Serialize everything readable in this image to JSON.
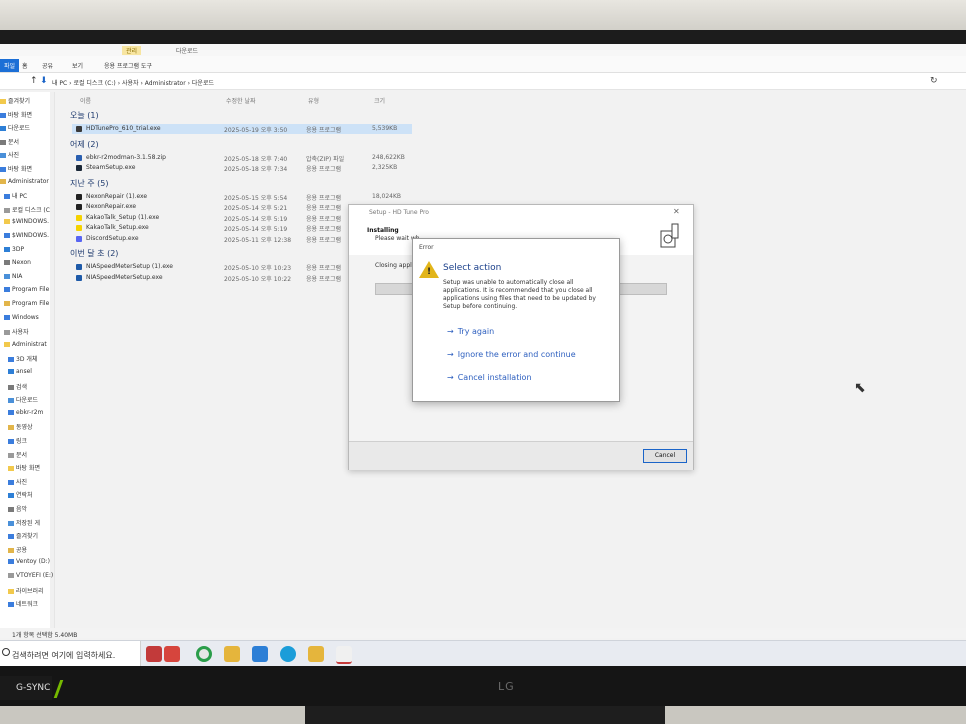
{
  "explorer": {
    "ribbon_tabs": {
      "manage": "관리",
      "downloads": "다운로드"
    },
    "ribbon": {
      "file": "파일",
      "home": "홈",
      "share": "공유",
      "view": "보기",
      "app_tools": "응용 프로그램 도구"
    },
    "address": {
      "crumbs": [
        "내 PC",
        "로컬 디스크 (C:)",
        "사용자",
        "Administrator",
        "다운로드"
      ]
    },
    "columns": {
      "name": "이름",
      "date": "수정한 날짜",
      "type": "유형",
      "size": "크기"
    },
    "nav_items": [
      "즐겨찾기",
      "바탕 화면",
      "다운로드",
      "문서",
      "사진",
      "바탕 화면",
      "Administrator",
      "내 PC",
      "로컬 디스크 (C",
      "$WINDOWS.",
      "$WINDOWS.",
      "3DP",
      "Nexon",
      "NIA",
      "Program File",
      "Program File",
      "Windows",
      "사용자",
      "Administrat",
      "3D 개체",
      "ansel",
      "검색",
      "다운로드",
      "ebkr-r2m",
      "동영상",
      "링크",
      "문서",
      "바탕 화면",
      "사진",
      "연락처",
      "음악",
      "저장된 게",
      "즐겨찾기",
      "공용",
      "Ventoy (D:)",
      "VTOYEFI (E:)",
      "라이브러리",
      "네트워크"
    ],
    "groups": [
      {
        "label": "오늘 (1)",
        "files": [
          {
            "name": "HDTunePro_610_trial.exe",
            "date": "2025-05-19 오후 3:50",
            "type": "응용 프로그램",
            "size": "5,539KB",
            "selected": true
          }
        ]
      },
      {
        "label": "어제 (2)",
        "files": [
          {
            "name": "ebkr-r2modman-3.1.58.zip",
            "date": "2025-05-18 오후 7:40",
            "type": "압축(ZIP) 파일",
            "size": "248,622KB"
          },
          {
            "name": "SteamSetup.exe",
            "date": "2025-05-18 오후 7:34",
            "type": "응용 프로그램",
            "size": "2,325KB"
          }
        ]
      },
      {
        "label": "지난 주 (5)",
        "files": [
          {
            "name": "NexonRepair (1).exe",
            "date": "2025-05-15 오후 5:54",
            "type": "응용 프로그램",
            "size": "18,024KB"
          },
          {
            "name": "NexonRepair.exe",
            "date": "2025-05-14 오후 5:21",
            "type": "응용 프로그램",
            "size": ""
          },
          {
            "name": "KakaoTalk_Setup (1).exe",
            "date": "2025-05-14 오후 5:19",
            "type": "응용 프로그램",
            "size": ""
          },
          {
            "name": "KakaoTalk_Setup.exe",
            "date": "2025-05-14 오후 5:19",
            "type": "응용 프로그램",
            "size": ""
          },
          {
            "name": "DiscordSetup.exe",
            "date": "2025-05-11 오후 12:38",
            "type": "응용 프로그램",
            "size": ""
          }
        ]
      },
      {
        "label": "이번 달 초 (2)",
        "files": [
          {
            "name": "NIASpeedMeterSetup (1).exe",
            "date": "2025-05-10 오후 10:23",
            "type": "응용 프로그램",
            "size": ""
          },
          {
            "name": "NIASpeedMeterSetup.exe",
            "date": "2025-05-10 오후 10:22",
            "type": "응용 프로그램",
            "size": ""
          }
        ]
      }
    ],
    "status": "1개 항목 선택함 5.40MB"
  },
  "taskbar": {
    "search_placeholder": "검색하려면 여기에 입력하세요."
  },
  "setup": {
    "title": "Setup - HD Tune Pro",
    "heading": "Installing",
    "sub": "Please wait wh",
    "closing": "Closing applica",
    "cancel_label": "Cancel"
  },
  "error_dialog": {
    "title": "Error",
    "heading": "Select action",
    "message": "Setup was unable to automatically close all applications. It is recommended that you close all applications using files that need to be updated by Setup before continuing.",
    "options": [
      "Try again",
      "Ignore the error and continue",
      "Cancel installation"
    ]
  },
  "monitor": {
    "badge": "G-SYNC",
    "brand": "LG"
  }
}
